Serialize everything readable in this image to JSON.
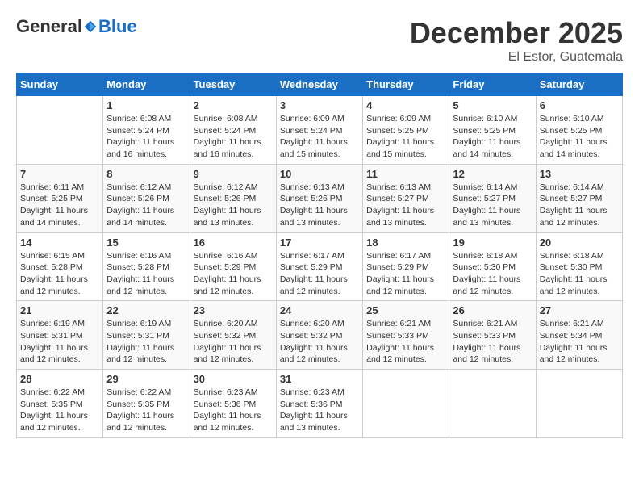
{
  "header": {
    "logo_general": "General",
    "logo_blue": "Blue",
    "month": "December 2025",
    "location": "El Estor, Guatemala"
  },
  "weekdays": [
    "Sunday",
    "Monday",
    "Tuesday",
    "Wednesday",
    "Thursday",
    "Friday",
    "Saturday"
  ],
  "weeks": [
    [
      {
        "day": "",
        "info": ""
      },
      {
        "day": "1",
        "info": "Sunrise: 6:08 AM\nSunset: 5:24 PM\nDaylight: 11 hours and 16 minutes."
      },
      {
        "day": "2",
        "info": "Sunrise: 6:08 AM\nSunset: 5:24 PM\nDaylight: 11 hours and 16 minutes."
      },
      {
        "day": "3",
        "info": "Sunrise: 6:09 AM\nSunset: 5:24 PM\nDaylight: 11 hours and 15 minutes."
      },
      {
        "day": "4",
        "info": "Sunrise: 6:09 AM\nSunset: 5:25 PM\nDaylight: 11 hours and 15 minutes."
      },
      {
        "day": "5",
        "info": "Sunrise: 6:10 AM\nSunset: 5:25 PM\nDaylight: 11 hours and 14 minutes."
      },
      {
        "day": "6",
        "info": "Sunrise: 6:10 AM\nSunset: 5:25 PM\nDaylight: 11 hours and 14 minutes."
      }
    ],
    [
      {
        "day": "7",
        "info": "Sunrise: 6:11 AM\nSunset: 5:25 PM\nDaylight: 11 hours and 14 minutes."
      },
      {
        "day": "8",
        "info": "Sunrise: 6:12 AM\nSunset: 5:26 PM\nDaylight: 11 hours and 14 minutes."
      },
      {
        "day": "9",
        "info": "Sunrise: 6:12 AM\nSunset: 5:26 PM\nDaylight: 11 hours and 13 minutes."
      },
      {
        "day": "10",
        "info": "Sunrise: 6:13 AM\nSunset: 5:26 PM\nDaylight: 11 hours and 13 minutes."
      },
      {
        "day": "11",
        "info": "Sunrise: 6:13 AM\nSunset: 5:27 PM\nDaylight: 11 hours and 13 minutes."
      },
      {
        "day": "12",
        "info": "Sunrise: 6:14 AM\nSunset: 5:27 PM\nDaylight: 11 hours and 13 minutes."
      },
      {
        "day": "13",
        "info": "Sunrise: 6:14 AM\nSunset: 5:27 PM\nDaylight: 11 hours and 12 minutes."
      }
    ],
    [
      {
        "day": "14",
        "info": "Sunrise: 6:15 AM\nSunset: 5:28 PM\nDaylight: 11 hours and 12 minutes."
      },
      {
        "day": "15",
        "info": "Sunrise: 6:16 AM\nSunset: 5:28 PM\nDaylight: 11 hours and 12 minutes."
      },
      {
        "day": "16",
        "info": "Sunrise: 6:16 AM\nSunset: 5:29 PM\nDaylight: 11 hours and 12 minutes."
      },
      {
        "day": "17",
        "info": "Sunrise: 6:17 AM\nSunset: 5:29 PM\nDaylight: 11 hours and 12 minutes."
      },
      {
        "day": "18",
        "info": "Sunrise: 6:17 AM\nSunset: 5:29 PM\nDaylight: 11 hours and 12 minutes."
      },
      {
        "day": "19",
        "info": "Sunrise: 6:18 AM\nSunset: 5:30 PM\nDaylight: 11 hours and 12 minutes."
      },
      {
        "day": "20",
        "info": "Sunrise: 6:18 AM\nSunset: 5:30 PM\nDaylight: 11 hours and 12 minutes."
      }
    ],
    [
      {
        "day": "21",
        "info": "Sunrise: 6:19 AM\nSunset: 5:31 PM\nDaylight: 11 hours and 12 minutes."
      },
      {
        "day": "22",
        "info": "Sunrise: 6:19 AM\nSunset: 5:31 PM\nDaylight: 11 hours and 12 minutes."
      },
      {
        "day": "23",
        "info": "Sunrise: 6:20 AM\nSunset: 5:32 PM\nDaylight: 11 hours and 12 minutes."
      },
      {
        "day": "24",
        "info": "Sunrise: 6:20 AM\nSunset: 5:32 PM\nDaylight: 11 hours and 12 minutes."
      },
      {
        "day": "25",
        "info": "Sunrise: 6:21 AM\nSunset: 5:33 PM\nDaylight: 11 hours and 12 minutes."
      },
      {
        "day": "26",
        "info": "Sunrise: 6:21 AM\nSunset: 5:33 PM\nDaylight: 11 hours and 12 minutes."
      },
      {
        "day": "27",
        "info": "Sunrise: 6:21 AM\nSunset: 5:34 PM\nDaylight: 11 hours and 12 minutes."
      }
    ],
    [
      {
        "day": "28",
        "info": "Sunrise: 6:22 AM\nSunset: 5:35 PM\nDaylight: 11 hours and 12 minutes."
      },
      {
        "day": "29",
        "info": "Sunrise: 6:22 AM\nSunset: 5:35 PM\nDaylight: 11 hours and 12 minutes."
      },
      {
        "day": "30",
        "info": "Sunrise: 6:23 AM\nSunset: 5:36 PM\nDaylight: 11 hours and 12 minutes."
      },
      {
        "day": "31",
        "info": "Sunrise: 6:23 AM\nSunset: 5:36 PM\nDaylight: 11 hours and 13 minutes."
      },
      {
        "day": "",
        "info": ""
      },
      {
        "day": "",
        "info": ""
      },
      {
        "day": "",
        "info": ""
      }
    ]
  ]
}
